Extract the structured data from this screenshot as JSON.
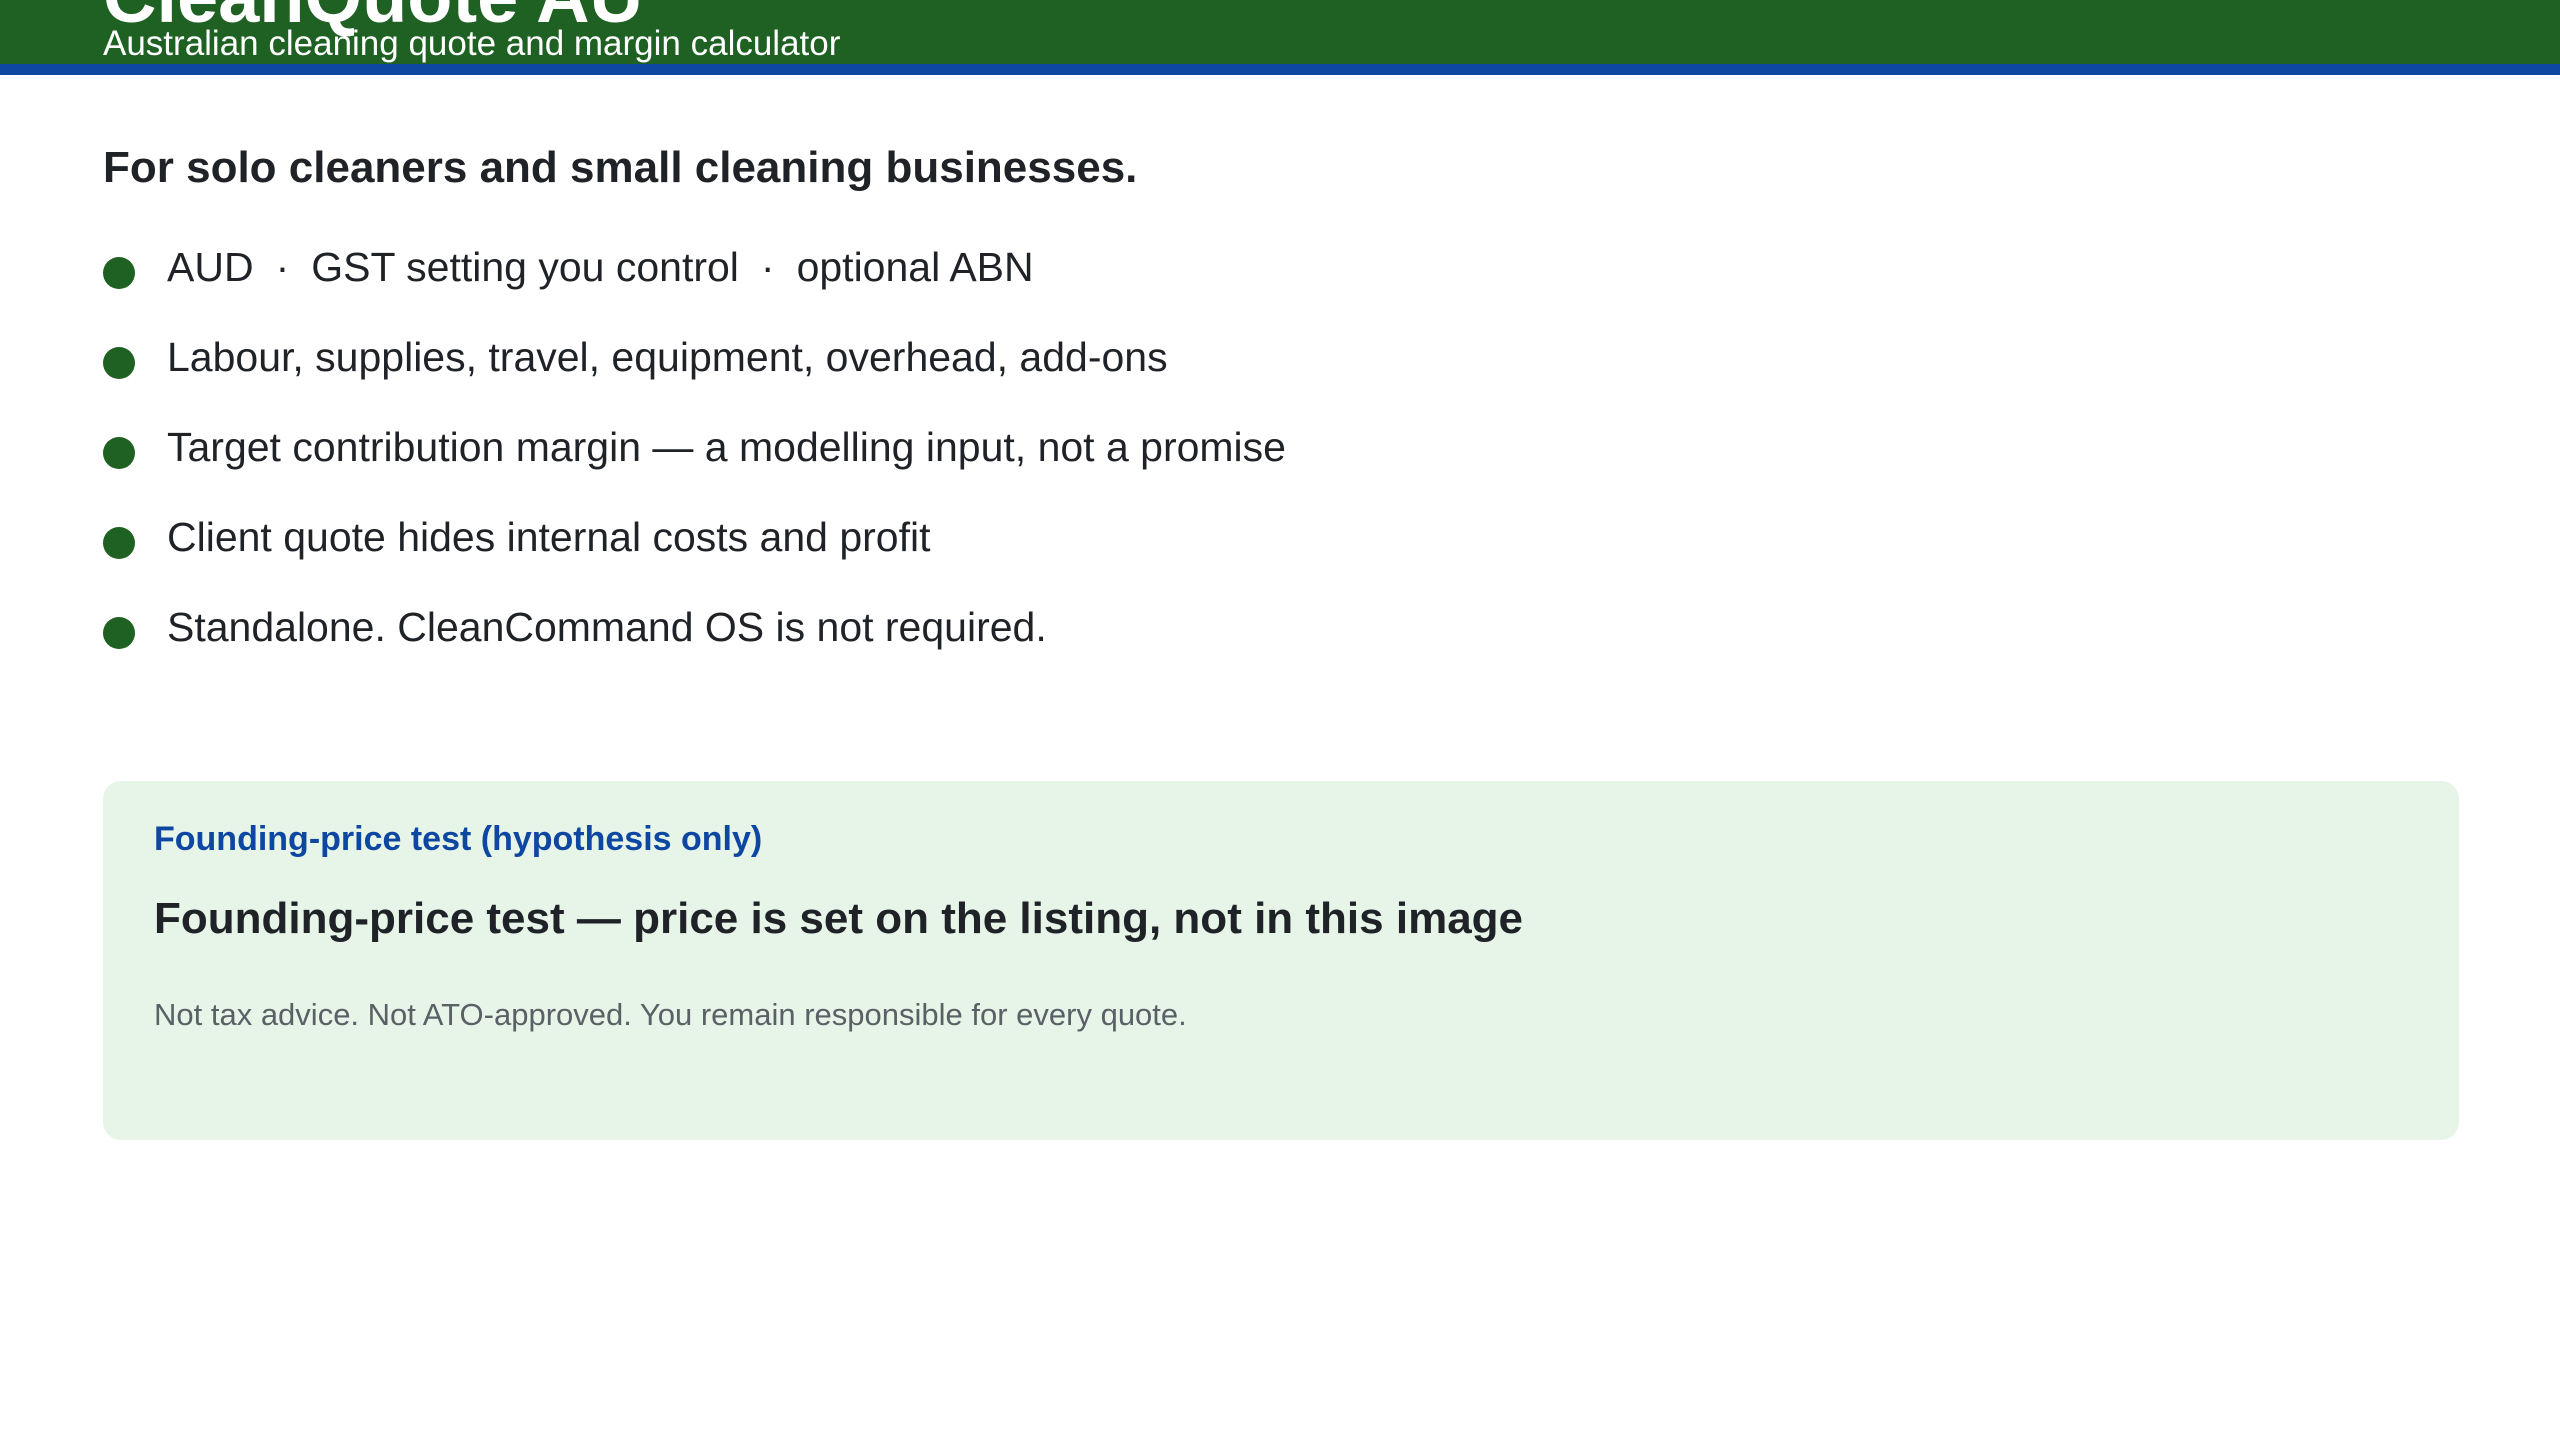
{
  "header": {
    "title": "CleanQuote AU",
    "subtitle": "Australian cleaning quote and margin calculator",
    "colors": {
      "background": "#1e6123",
      "stripe": "#0d47a1"
    }
  },
  "intro": {
    "headline": "For solo cleaners and small cleaning businesses."
  },
  "features": {
    "item1": {
      "part1": "AUD",
      "separator": "·",
      "part2": "GST setting you control",
      "part3": "optional ABN"
    },
    "item2": "Labour, supplies, travel, equipment, overhead, add-ons",
    "item3": "Target contribution margin — a modelling input, not a promise",
    "item4": "Client quote hides internal costs and profit",
    "item5": "Standalone. CleanCommand OS is not required.",
    "bullet_color": "#1e6123"
  },
  "callout": {
    "eyebrow": "Founding-price test (hypothesis only)",
    "title": "Founding-price test — price is set on the listing, not in this image",
    "disclaimer": "Not tax advice. Not ATO-approved. You remain responsible for every quote.",
    "background": "#e7f4e8",
    "eyebrow_color": "#0d47a1"
  }
}
